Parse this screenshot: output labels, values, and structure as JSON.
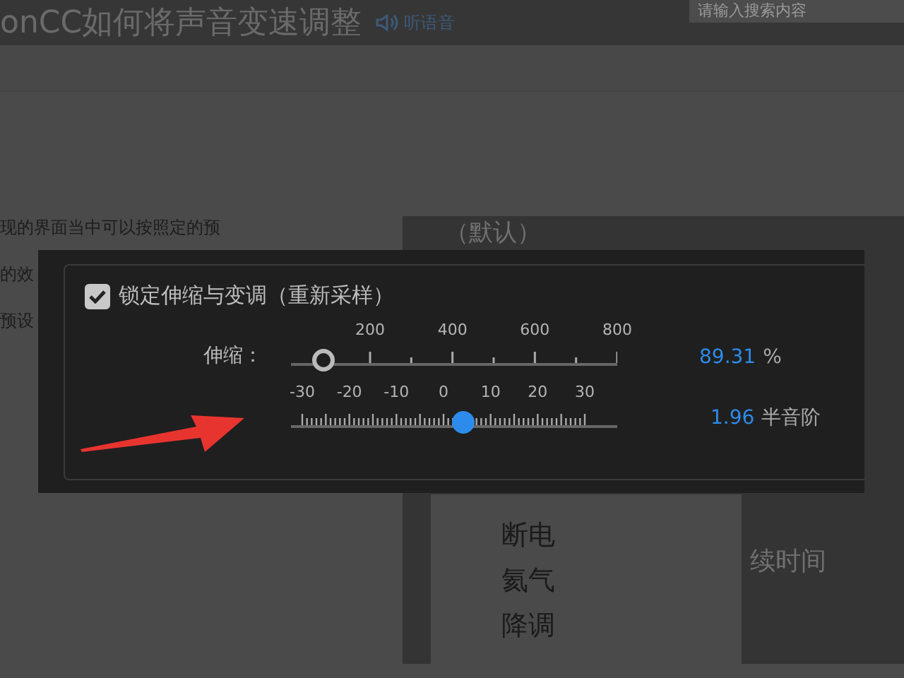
{
  "page": {
    "title": "onCC如何将声音变速调整",
    "listen_link": "听语音",
    "search": {
      "placeholder": "请输入搜索内容"
    },
    "body_lines": [
      "现的界面当中可以按照定的预",
      "的效",
      "预设"
    ],
    "panel": {
      "title": "（默认）",
      "menu_items": [
        "断电",
        "氦气",
        "降调"
      ],
      "side_label": "续时间"
    }
  },
  "dialog": {
    "lock": {
      "label": "锁定伸缩与变调（重新采样）",
      "checked": true
    },
    "sliders": [
      {
        "kind": "hollow",
        "label": "伸缩：",
        "ticks": [
          "200",
          "400",
          "600",
          "800"
        ],
        "level": 0.1,
        "value": "89.31",
        "unit": "%"
      },
      {
        "kind": "filled",
        "ticks": [
          "-30",
          "-20",
          "-10",
          "0",
          "10",
          "20",
          "30"
        ],
        "level": 0.53,
        "value": "1.96",
        "unit": "半音阶"
      }
    ]
  }
}
